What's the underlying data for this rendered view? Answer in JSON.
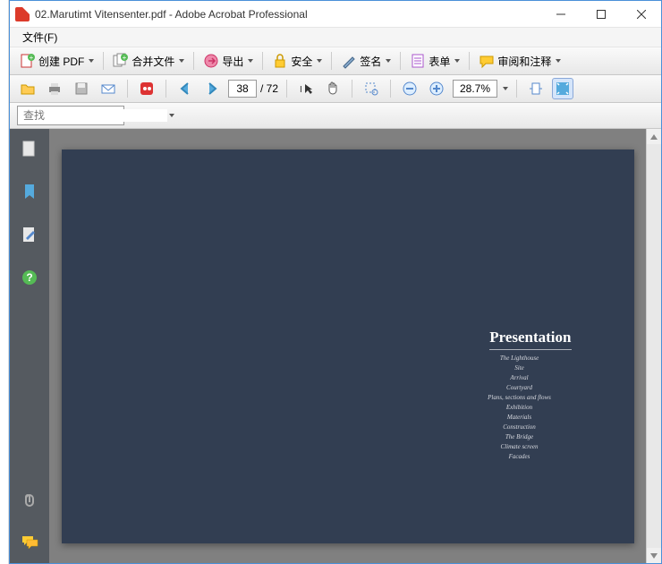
{
  "window": {
    "title": "02.Marutimt Vitensenter.pdf - Adobe Acrobat Professional"
  },
  "menubar": {
    "file": "文件(F)"
  },
  "toolbar1": {
    "create_pdf": "创建 PDF",
    "merge": "合并文件",
    "export": "导出",
    "secure": "安全",
    "sign": "签名",
    "forms": "表单",
    "review": "审阅和注释"
  },
  "nav": {
    "current_page": "38",
    "page_sep": "/ 72",
    "zoom": "28.7%"
  },
  "find": {
    "placeholder": "查找"
  },
  "document": {
    "section_title": "Presentation",
    "items": [
      "The Lighthouse",
      "Site",
      "Arrival",
      "Courtyard",
      "Plans, sections and flows",
      "Exhibition",
      "Materials",
      "Construction",
      "The Bridge",
      "Climate screen",
      "Facades"
    ]
  }
}
